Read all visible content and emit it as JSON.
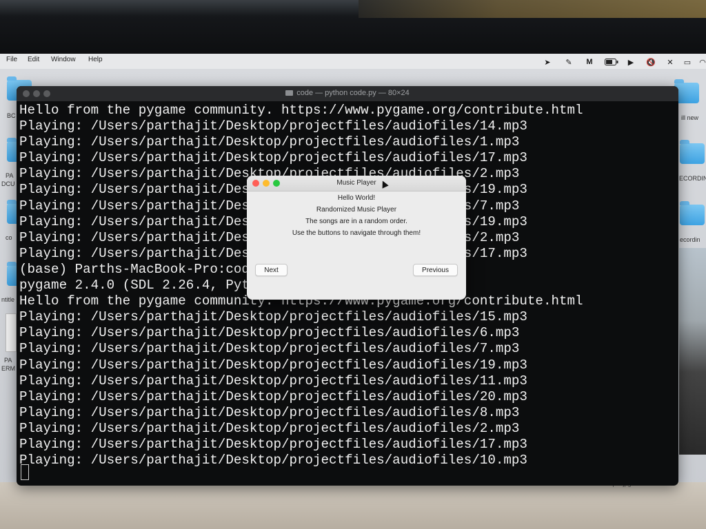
{
  "menubar": {
    "items": [
      "File",
      "Edit",
      "Window",
      "Help"
    ],
    "status_icons": [
      "location-arrow-icon",
      "pen-icon",
      "m-app-icon",
      "battery-icon",
      "play-icon",
      "mute-icon",
      "no-mic-icon",
      "message-icon",
      "wifi-icon"
    ]
  },
  "desktop": {
    "left_labels": [
      "BC",
      "PA",
      "DCU",
      "co",
      "ntitle",
      "PA",
      "ERM"
    ],
    "right_labels": [
      "ill new",
      "ECORDIN",
      "ecordin"
    ],
    "bottom_file": "output.jpg"
  },
  "terminal": {
    "title": "code — python code.py — 80×24",
    "lines": [
      "Hello from the pygame community. https://www.pygame.org/contribute.html",
      "Playing: /Users/parthajit/Desktop/projectfiles/audiofiles/14.mp3",
      "Playing: /Users/parthajit/Desktop/projectfiles/audiofiles/1.mp3",
      "Playing: /Users/parthajit/Desktop/projectfiles/audiofiles/17.mp3",
      "Playing: /Users/parthajit/Desktop/projectfiles/audiofiles/2.mp3",
      "Playing: /Users/parthajit/Desktop/projectfiles/audiofiles/19.mp3",
      "Playing: /Users/parthajit/Desktop/projectfiles/audiofiles/7.mp3",
      "Playing: /Users/parthajit/Desktop/projectfiles/audiofiles/19.mp3",
      "Playing: /Users/parthajit/Desktop/projectfiles/audiofiles/2.mp3",
      "Playing: /Users/parthajit/Desktop/projectfiles/audiofiles/17.mp3",
      "(base) Parths-MacBook-Pro:code parthajit$ python code.py",
      "pygame 2.4.0 (SDL 2.26.4, Python 3.9.13)",
      "Hello from the pygame community. https://www.pygame.org/contribute.html",
      "Playing: /Users/parthajit/Desktop/projectfiles/audiofiles/15.mp3",
      "Playing: /Users/parthajit/Desktop/projectfiles/audiofiles/6.mp3",
      "Playing: /Users/parthajit/Desktop/projectfiles/audiofiles/7.mp3",
      "Playing: /Users/parthajit/Desktop/projectfiles/audiofiles/19.mp3",
      "Playing: /Users/parthajit/Desktop/projectfiles/audiofiles/11.mp3",
      "Playing: /Users/parthajit/Desktop/projectfiles/audiofiles/20.mp3",
      "Playing: /Users/parthajit/Desktop/projectfiles/audiofiles/8.mp3",
      "Playing: /Users/parthajit/Desktop/projectfiles/audiofiles/2.mp3",
      "Playing: /Users/parthajit/Desktop/projectfiles/audiofiles/17.mp3",
      "Playing: /Users/parthajit/Desktop/projectfiles/audiofiles/10.mp3"
    ]
  },
  "dialog": {
    "title": "Music Player",
    "lines": [
      "Hello World!",
      "Randomized Music Player",
      "The songs are in a random order.",
      "Use the buttons to navigate through them!"
    ],
    "next_label": "Next",
    "previous_label": "Previous"
  },
  "colors": {
    "close": "#ff5f57",
    "minimize": "#febc2e",
    "zoom": "#28c840",
    "terminal_bg": "#0c0d0e",
    "terminal_text": "#f1f1f1",
    "folder_blue": "#3ea3e3"
  }
}
